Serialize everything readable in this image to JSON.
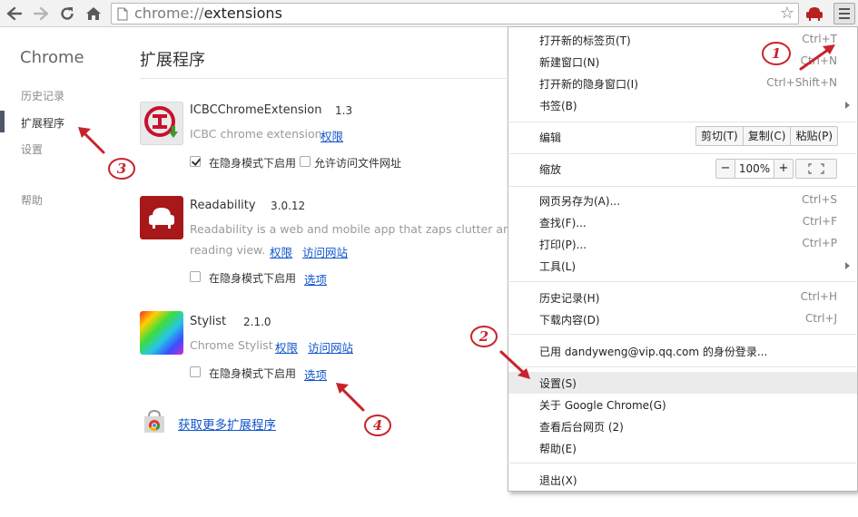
{
  "omnibox": {
    "scheme": "chrome://",
    "host": "extensions"
  },
  "sidebar": {
    "title": "Chrome",
    "items": [
      {
        "label": "历史记录",
        "active": false
      },
      {
        "label": "扩展程序",
        "active": true
      },
      {
        "label": "设置",
        "active": false
      },
      {
        "label": "帮助",
        "active": false
      }
    ]
  },
  "main": {
    "title": "扩展程序",
    "extensions": [
      {
        "name": "ICBCChromeExtension",
        "version": "1.3",
        "description": "ICBC chrome extension",
        "permissions_link": "权限",
        "incognito_label": "在隐身模式下启用",
        "incognito_checked": true,
        "file_access_label": "允许访问文件网址",
        "file_access_checked": false
      },
      {
        "name": "Readability",
        "version": "3.0.12",
        "description_line1": "Readability is a web and mobile app that zaps clutter and sa",
        "description_line2": "reading view.",
        "permissions_link": "权限",
        "website_link": "访问网站",
        "incognito_label": "在隐身模式下启用",
        "incognito_checked": false,
        "options_link": "选项"
      },
      {
        "name": "Stylist",
        "version": "2.1.0",
        "description": "Chrome Stylist",
        "permissions_link": "权限",
        "website_link": "访问网站",
        "incognito_label": "在隐身模式下启用",
        "incognito_checked": false,
        "options_link": "选项"
      }
    ],
    "more_extensions_link": "获取更多扩展程序"
  },
  "menu": {
    "items": [
      {
        "label": "打开新的标签页(T)",
        "shortcut": "Ctrl+T"
      },
      {
        "label": "新建窗口(N)",
        "shortcut": "Ctrl+N"
      },
      {
        "label": "打开新的隐身窗口(I)",
        "shortcut": "Ctrl+Shift+N"
      },
      {
        "label": "书签(B)",
        "shortcut": ""
      },
      {
        "label": "编辑",
        "shortcut": ""
      },
      {
        "label": "缩放",
        "shortcut": ""
      },
      {
        "label": "网页另存为(A)...",
        "shortcut": "Ctrl+S"
      },
      {
        "label": "查找(F)...",
        "shortcut": "Ctrl+F"
      },
      {
        "label": "打印(P)...",
        "shortcut": "Ctrl+P"
      },
      {
        "label": "工具(L)",
        "shortcut": ""
      },
      {
        "label": "历史记录(H)",
        "shortcut": "Ctrl+H"
      },
      {
        "label": "下载内容(D)",
        "shortcut": "Ctrl+J"
      },
      {
        "label": "已用 dandyweng@vip.qq.com 的身份登录...",
        "shortcut": ""
      },
      {
        "label": "设置(S)",
        "shortcut": ""
      },
      {
        "label": "关于 Google Chrome(G)",
        "shortcut": ""
      },
      {
        "label": "查看后台网页 (2)",
        "shortcut": ""
      },
      {
        "label": "帮助(E)",
        "shortcut": ""
      },
      {
        "label": "退出(X)",
        "shortcut": ""
      }
    ],
    "edit": {
      "cut": "剪切(T)",
      "copy": "复制(C)",
      "paste": "粘贴(P)"
    },
    "zoom": {
      "minus": "−",
      "value": "100%",
      "plus": "+"
    }
  },
  "annotations": {
    "one": "1",
    "two": "2",
    "three": "3",
    "four": "4",
    "color": "#c8232c"
  },
  "colors": {
    "link": "#1155cc",
    "annotation_red": "#c8232c"
  }
}
